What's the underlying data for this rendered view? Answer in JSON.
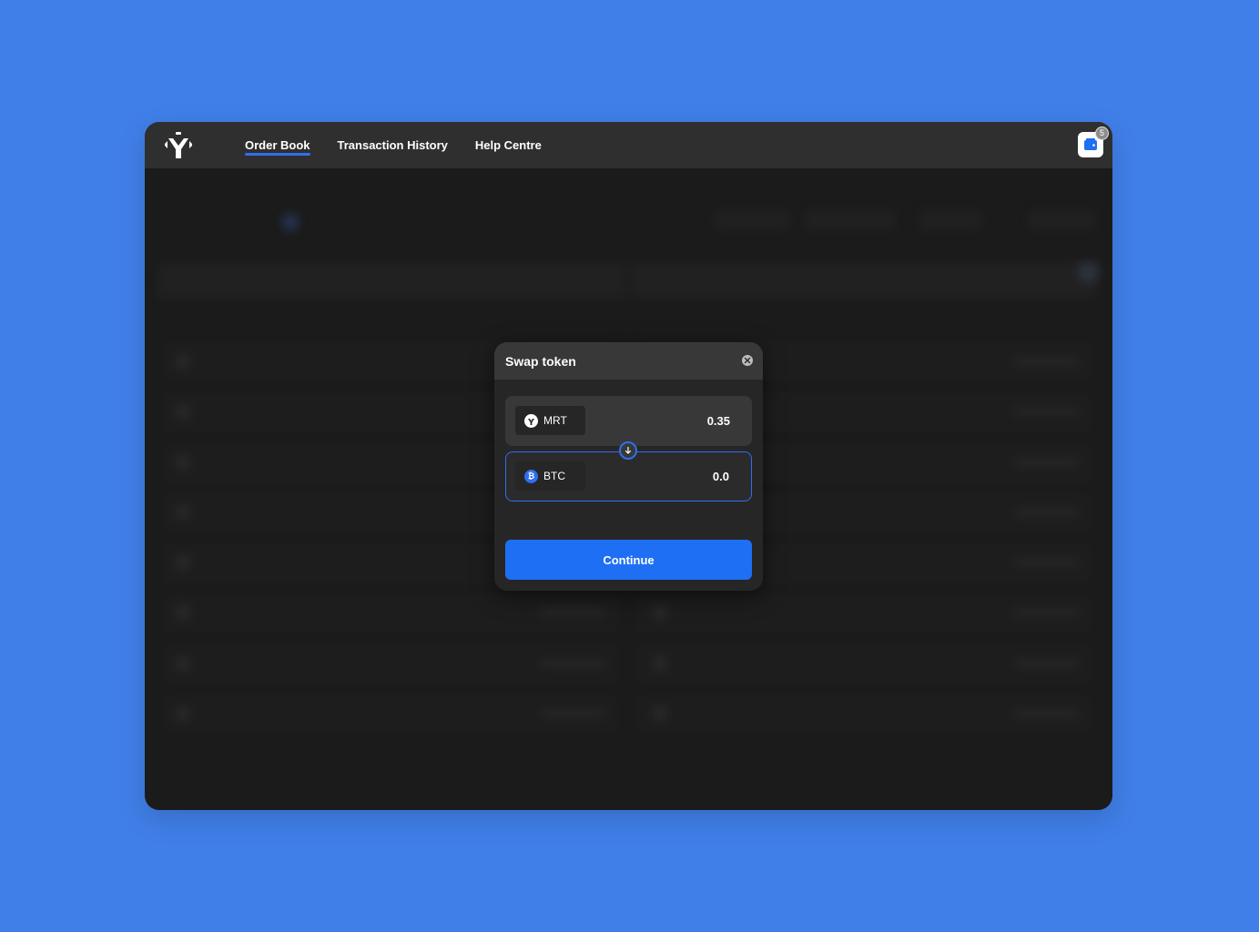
{
  "nav": {
    "items": [
      {
        "label": "Order Book",
        "active": true
      },
      {
        "label": "Transaction History",
        "active": false
      },
      {
        "label": "Help Centre",
        "active": false
      }
    ]
  },
  "wallet": {
    "badge": "5",
    "icon": "wallet-icon"
  },
  "modal": {
    "title": "Swap token",
    "from": {
      "token": "MRT",
      "amount": "0.35",
      "icon": "mrt-token-icon"
    },
    "to": {
      "token": "BTC",
      "amount": "0.0",
      "icon": "btc-token-icon"
    },
    "continue_label": "Continue"
  },
  "colors": {
    "background": "#407fe8",
    "accent": "#1f6ff5",
    "panel": "#222222"
  }
}
